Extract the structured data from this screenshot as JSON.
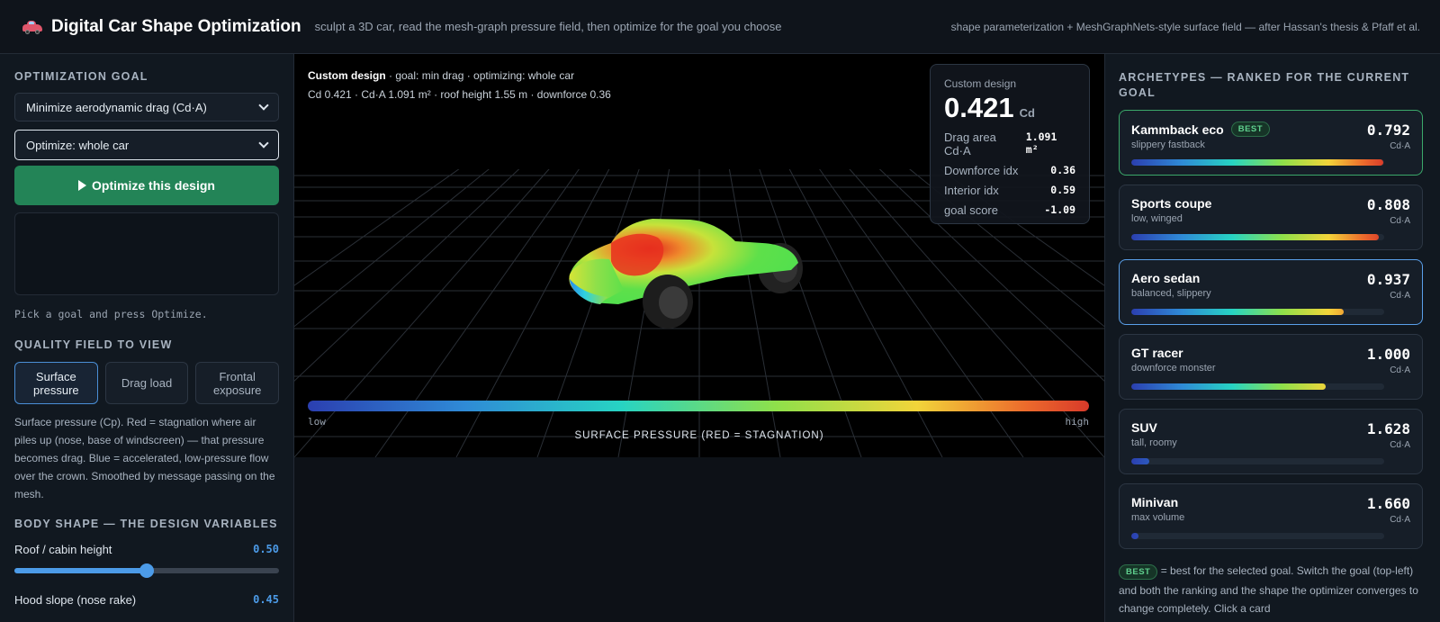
{
  "header": {
    "logo": "car-emoji",
    "title": "Digital Car Shape Optimization",
    "subtitle": "sculpt a 3D car, read the mesh-graph pressure field, then optimize for the goal you choose",
    "credit": "shape parameterization + MeshGraphNets-style surface field — after Hassan's thesis & Pfaff et al."
  },
  "left": {
    "goal_title": "OPTIMIZATION GOAL",
    "goal_select": "Minimize aerodynamic drag (Cd·A)",
    "scope_select": "Optimize: whole car",
    "optimize_button": "Optimize this design",
    "log_hint": "Pick a goal and press Optimize.",
    "field_title": "QUALITY FIELD TO VIEW",
    "field_buttons": [
      {
        "l1": "Surface",
        "l2": "pressure"
      },
      {
        "l1": "Drag load",
        "l2": ""
      },
      {
        "l1": "Frontal",
        "l2": "exposure"
      }
    ],
    "field_description": "Surface pressure (Cp). Red = stagnation where air piles up (nose, base of windscreen) — that pressure becomes drag. Blue = accelerated, low-pressure flow over the crown. Smoothed by message passing on the mesh.",
    "body_title": "BODY SHAPE — THE DESIGN VARIABLES",
    "sliders": [
      {
        "label": "Roof / cabin height",
        "value": "0.50",
        "fraction": 0.5
      },
      {
        "label": "Hood slope (nose rake)",
        "value": "0.45",
        "fraction": 0.45
      }
    ]
  },
  "viewport": {
    "design_name": "Custom design",
    "design_meta": " · goal: min drag · optimizing: whole car",
    "metrics_line": "Cd 0.421 · Cd·A 1.091 m² · roof height 1.55 m · downforce 0.36",
    "colorbar_low": "low",
    "colorbar_high": "high",
    "colorbar_title": "SURFACE PRESSURE (RED = STAGNATION)"
  },
  "stats": {
    "label": "Custom design",
    "cd_value": "0.421",
    "cd_unit": "Cd",
    "rows": [
      {
        "label": "Drag area Cd·A",
        "value": "1.091 m²"
      },
      {
        "label": "Downforce idx",
        "value": "0.36"
      },
      {
        "label": "Interior idx",
        "value": "0.59"
      },
      {
        "label": "goal score",
        "value": "-1.09"
      }
    ]
  },
  "right": {
    "title": "ARCHETYPES — RANKED FOR THE CURRENT GOAL",
    "best_tag": "BEST",
    "unit": "Cd·A",
    "cards": [
      {
        "name": "Kammback eco",
        "sub": "slippery fastback",
        "score": "0.792",
        "best": true,
        "fill": 0.995
      },
      {
        "name": "Sports coupe",
        "sub": "low, winged",
        "score": "0.808",
        "best": false,
        "fill": 0.98
      },
      {
        "name": "Aero sedan",
        "sub": "balanced, slippery",
        "score": "0.937",
        "best": false,
        "fill": 0.84
      },
      {
        "name": "GT racer",
        "sub": "downforce monster",
        "score": "1.000",
        "best": false,
        "fill": 0.77
      },
      {
        "name": "SUV",
        "sub": "tall, roomy",
        "score": "1.628",
        "best": false,
        "fill": 0.07
      },
      {
        "name": "Minivan",
        "sub": "max volume",
        "score": "1.660",
        "best": false,
        "fill": 0.03
      }
    ],
    "note": "= best for the selected goal. Switch the goal (top-left) and both the ranking and the shape the optimizer converges to change completely. Click a card"
  }
}
